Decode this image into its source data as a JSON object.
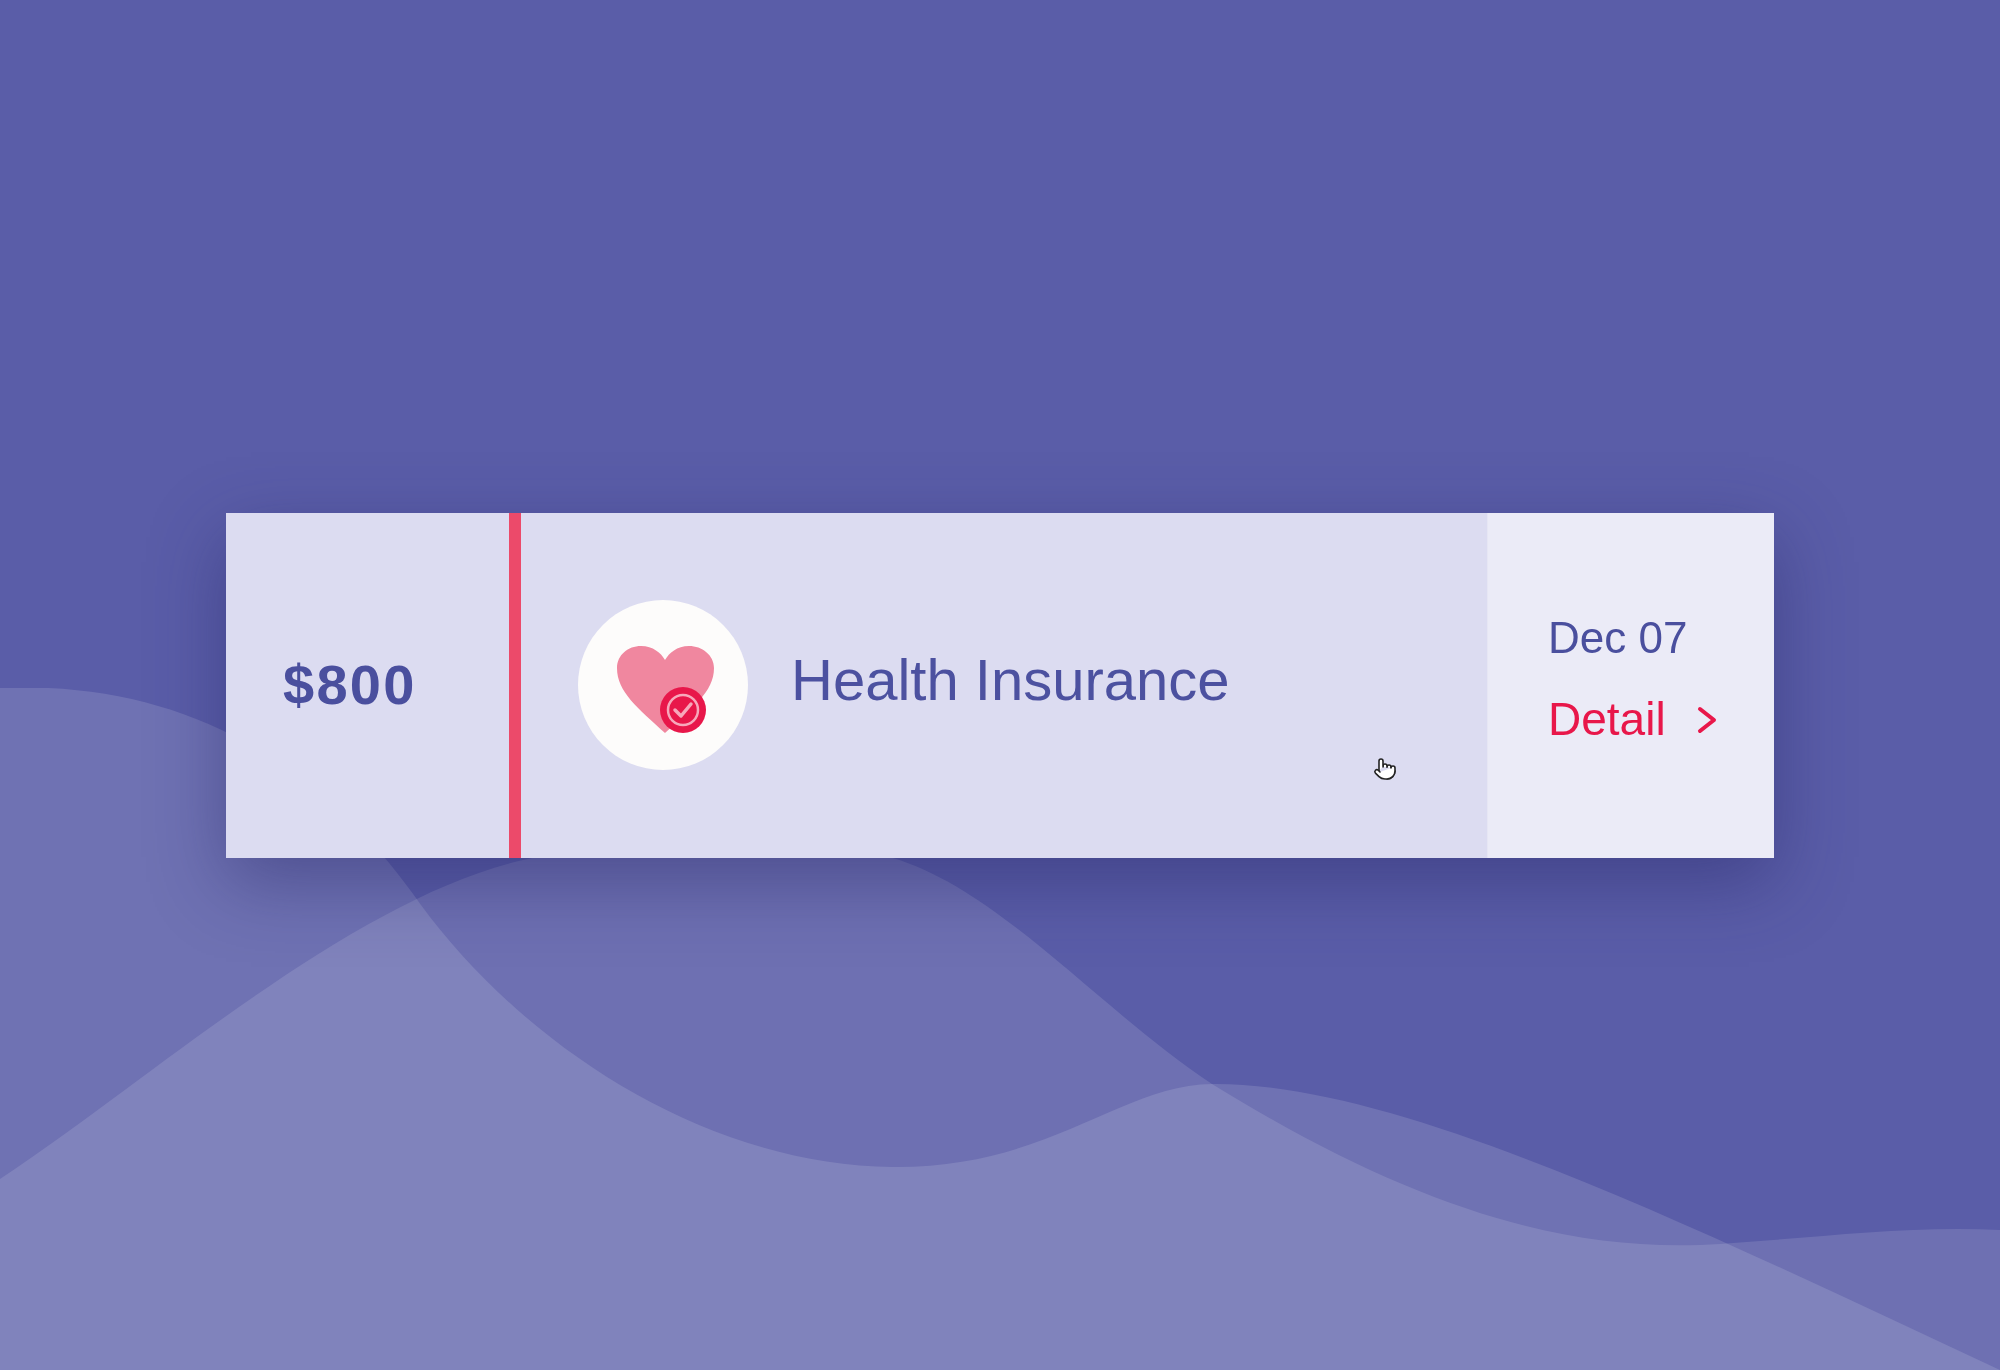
{
  "payment": {
    "amount": "$800",
    "title": "Health Insurance",
    "date": "Dec 07",
    "detail_link": "Detail"
  }
}
